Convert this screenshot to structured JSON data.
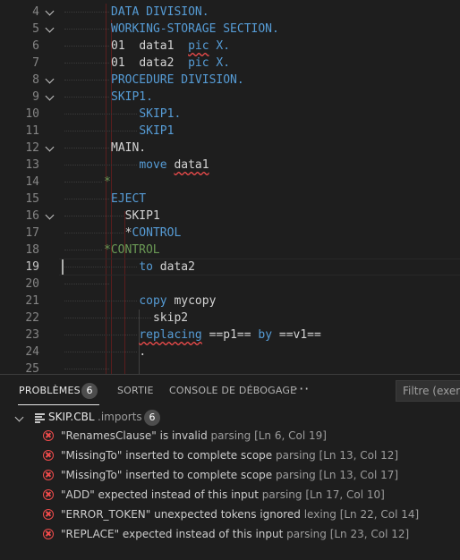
{
  "editor": {
    "lines": [
      {
        "n": "4",
        "fold": true,
        "tokens": [
          {
            "t": "DATA DIVISION.",
            "c": "kw"
          }
        ],
        "indent": 0
      },
      {
        "n": "5",
        "fold": true,
        "tokens": [
          {
            "t": "WORKING-STORAGE SECTION.",
            "c": "kw"
          }
        ],
        "indent": 0
      },
      {
        "n": "6",
        "fold": false,
        "tokens": [
          {
            "t": "01  ",
            "c": "id"
          },
          {
            "t": "data1",
            "c": "id"
          },
          {
            "t": "  ",
            "c": "id"
          },
          {
            "t": "pic",
            "c": "kw sq"
          },
          {
            "t": " X.",
            "c": "kw"
          }
        ],
        "indent": 0
      },
      {
        "n": "7",
        "fold": false,
        "tokens": [
          {
            "t": "01  ",
            "c": "id"
          },
          {
            "t": "data2",
            "c": "id"
          },
          {
            "t": "  ",
            "c": "id"
          },
          {
            "t": "pic X.",
            "c": "kw"
          }
        ],
        "indent": 0
      },
      {
        "n": "8",
        "fold": true,
        "tokens": [
          {
            "t": "PROCEDURE DIVISION.",
            "c": "kw"
          }
        ],
        "indent": 0
      },
      {
        "n": "9",
        "fold": true,
        "tokens": [
          {
            "t": "SKIP1.",
            "c": "kw"
          }
        ],
        "indent": 0
      },
      {
        "n": "10",
        "fold": false,
        "tokens": [
          {
            "t": "SKIP1.",
            "c": "kw"
          }
        ],
        "indent": 4
      },
      {
        "n": "11",
        "fold": false,
        "tokens": [
          {
            "t": "SKIP1",
            "c": "kw"
          }
        ],
        "indent": 4
      },
      {
        "n": "12",
        "fold": true,
        "tokens": [
          {
            "t": "MAIN.",
            "c": "id"
          }
        ],
        "indent": 0
      },
      {
        "n": "13",
        "fold": false,
        "tokens": [
          {
            "t": "move",
            "c": "kw"
          },
          {
            "t": " ",
            "c": "id"
          },
          {
            "t": "data1",
            "c": "id sq"
          }
        ],
        "indent": 4
      },
      {
        "n": "14",
        "fold": false,
        "tokens": [
          {
            "t": "*",
            "c": "cm"
          }
        ],
        "indent": -1
      },
      {
        "n": "15",
        "fold": false,
        "tokens": [
          {
            "t": "EJECT",
            "c": "kw"
          }
        ],
        "indent": 0
      },
      {
        "n": "16",
        "fold": true,
        "tokens": [
          {
            "t": "SKIP1",
            "c": "id"
          }
        ],
        "indent": 2
      },
      {
        "n": "17",
        "fold": false,
        "tokens": [
          {
            "t": "*",
            "c": "id"
          },
          {
            "t": "CONTROL",
            "c": "kw"
          }
        ],
        "indent": 2
      },
      {
        "n": "18",
        "fold": false,
        "tokens": [
          {
            "t": "*CONTROL",
            "c": "cm"
          }
        ],
        "indent": -1
      },
      {
        "n": "19",
        "fold": false,
        "tokens": [
          {
            "t": "to",
            "c": "kw"
          },
          {
            "t": " ",
            "c": "id"
          },
          {
            "t": "data2",
            "c": "id"
          }
        ],
        "indent": 4
      },
      {
        "n": "20",
        "fold": false,
        "tokens": [],
        "indent": 0
      },
      {
        "n": "21",
        "fold": false,
        "tokens": [
          {
            "t": "copy",
            "c": "kw"
          },
          {
            "t": " mycopy",
            "c": "id"
          }
        ],
        "indent": 4
      },
      {
        "n": "22",
        "fold": false,
        "tokens": [
          {
            "t": "skip2",
            "c": "id"
          }
        ],
        "indent": 6
      },
      {
        "n": "23",
        "fold": false,
        "tokens": [
          {
            "t": "replacing",
            "c": "kw sq"
          },
          {
            "t": " ==p1== ",
            "c": "id"
          },
          {
            "t": "by",
            "c": "kw"
          },
          {
            "t": " ==v1==",
            "c": "id"
          }
        ],
        "indent": 4
      },
      {
        "n": "24",
        "fold": false,
        "tokens": [
          {
            "t": ".",
            "c": "id"
          }
        ],
        "indent": 4
      },
      {
        "n": "25",
        "fold": false,
        "tokens": [],
        "indent": 0
      }
    ],
    "active_line": "19"
  },
  "panel": {
    "tabs": [
      {
        "label": "PROBLÈMES",
        "active": true
      },
      {
        "label": "SORTIE",
        "active": false
      },
      {
        "label": "CONSOLE DE DÉBOGAGE",
        "active": false
      }
    ],
    "problems_count": "6",
    "more_label": "···",
    "filter_placeholder": "Filtre (exemp",
    "file": {
      "name": "SKIP.CBL",
      "dir": ".imports",
      "count": "6"
    },
    "problems": [
      {
        "msg": "\"RenamesClause\" is invalid",
        "source": "parsing",
        "loc": "[Ln 6, Col 19]"
      },
      {
        "msg": "\"MissingTo\" inserted to complete scope",
        "source": "parsing",
        "loc": "[Ln 13, Col 12]"
      },
      {
        "msg": "\"MissingTo\" inserted to complete scope",
        "source": "parsing",
        "loc": "[Ln 13, Col 17]"
      },
      {
        "msg": "\"ADD\" expected instead of this input",
        "source": "parsing",
        "loc": "[Ln 17, Col 10]"
      },
      {
        "msg": "\"ERROR_TOKEN\" unexpected tokens ignored",
        "source": "lexing",
        "loc": "[Ln 22, Col 14]"
      },
      {
        "msg": "\"REPLACE\" expected instead of this input",
        "source": "parsing",
        "loc": "[Ln 23, Col 12]"
      }
    ],
    "colors": {
      "error": "#f14c4c",
      "keyword": "#569cd6",
      "comment": "#6a9955",
      "background": "#1e1e1e"
    }
  }
}
